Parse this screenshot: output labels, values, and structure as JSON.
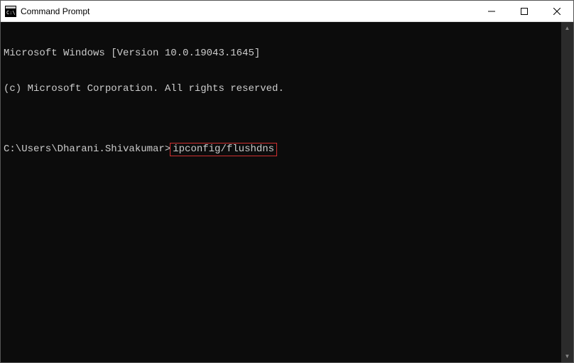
{
  "titlebar": {
    "title": "Command Prompt"
  },
  "terminal": {
    "line1": "Microsoft Windows [Version 10.0.19043.1645]",
    "line2": "(c) Microsoft Corporation. All rights reserved.",
    "blank": "",
    "prompt": "C:\\Users\\Dharani.Shivakumar>",
    "command": "ipconfig/flushdns"
  },
  "window_controls": {
    "minimize": "─",
    "maximize": "☐",
    "close": "✕"
  },
  "scroll": {
    "up": "▲",
    "down": "▼"
  }
}
